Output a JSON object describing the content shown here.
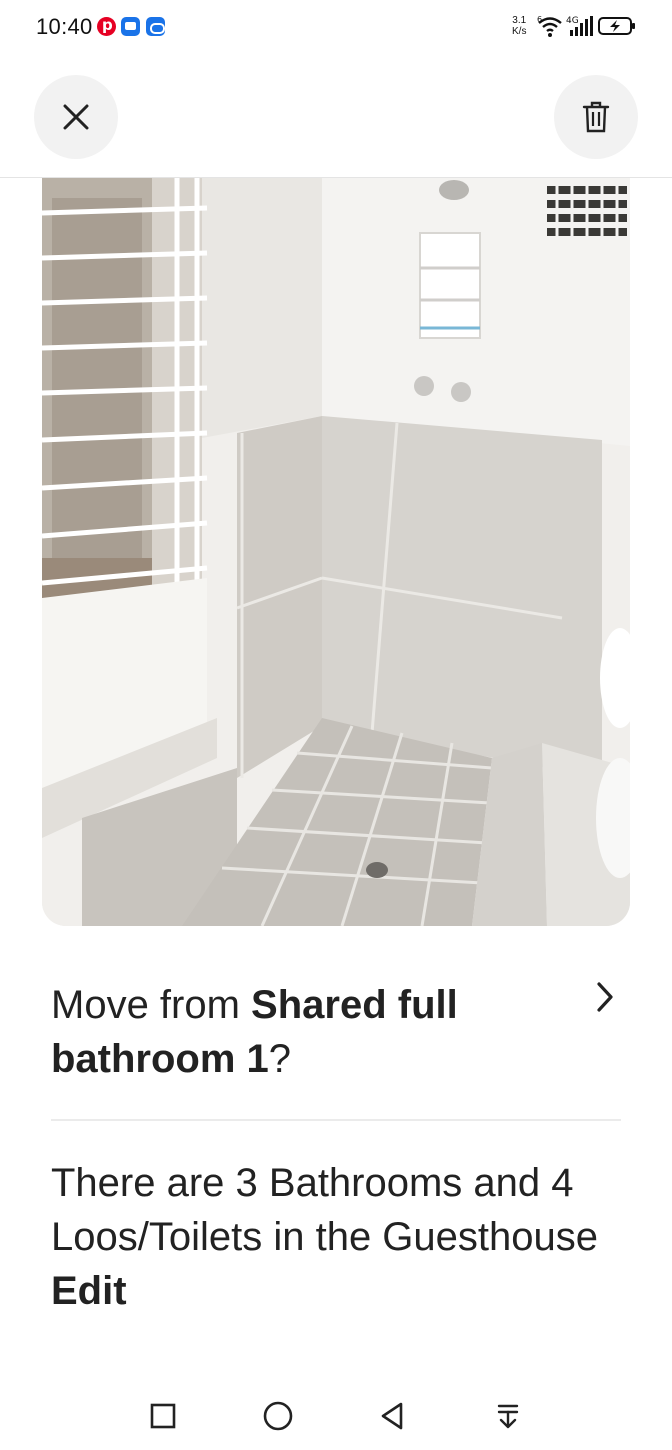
{
  "status_bar": {
    "time": "10:40",
    "network_speed_value": "3.1",
    "network_speed_unit": "K/s",
    "wifi_badge": "6",
    "signal_label": "4G",
    "notifications": [
      "pinterest-icon",
      "message-icon",
      "cloud-icon"
    ]
  },
  "header": {
    "close_icon": "close-icon",
    "delete_icon": "trash-icon"
  },
  "photo": {
    "subject": "bathroom-photo"
  },
  "move_row": {
    "prefix": "Move from ",
    "room_name": "Shared full bathroom 1",
    "suffix": "?"
  },
  "description": {
    "text": "There are 3 Bathrooms and 4 Loos/Toilets in the Guesthouse ",
    "edit_label": "Edit"
  },
  "nav_bar": {
    "items": [
      "recents-icon",
      "home-icon",
      "back-icon",
      "notification-shade-icon"
    ]
  },
  "colors": {
    "text": "#222222",
    "button_bg": "#f2f2f2",
    "divider": "#ebebeb"
  }
}
